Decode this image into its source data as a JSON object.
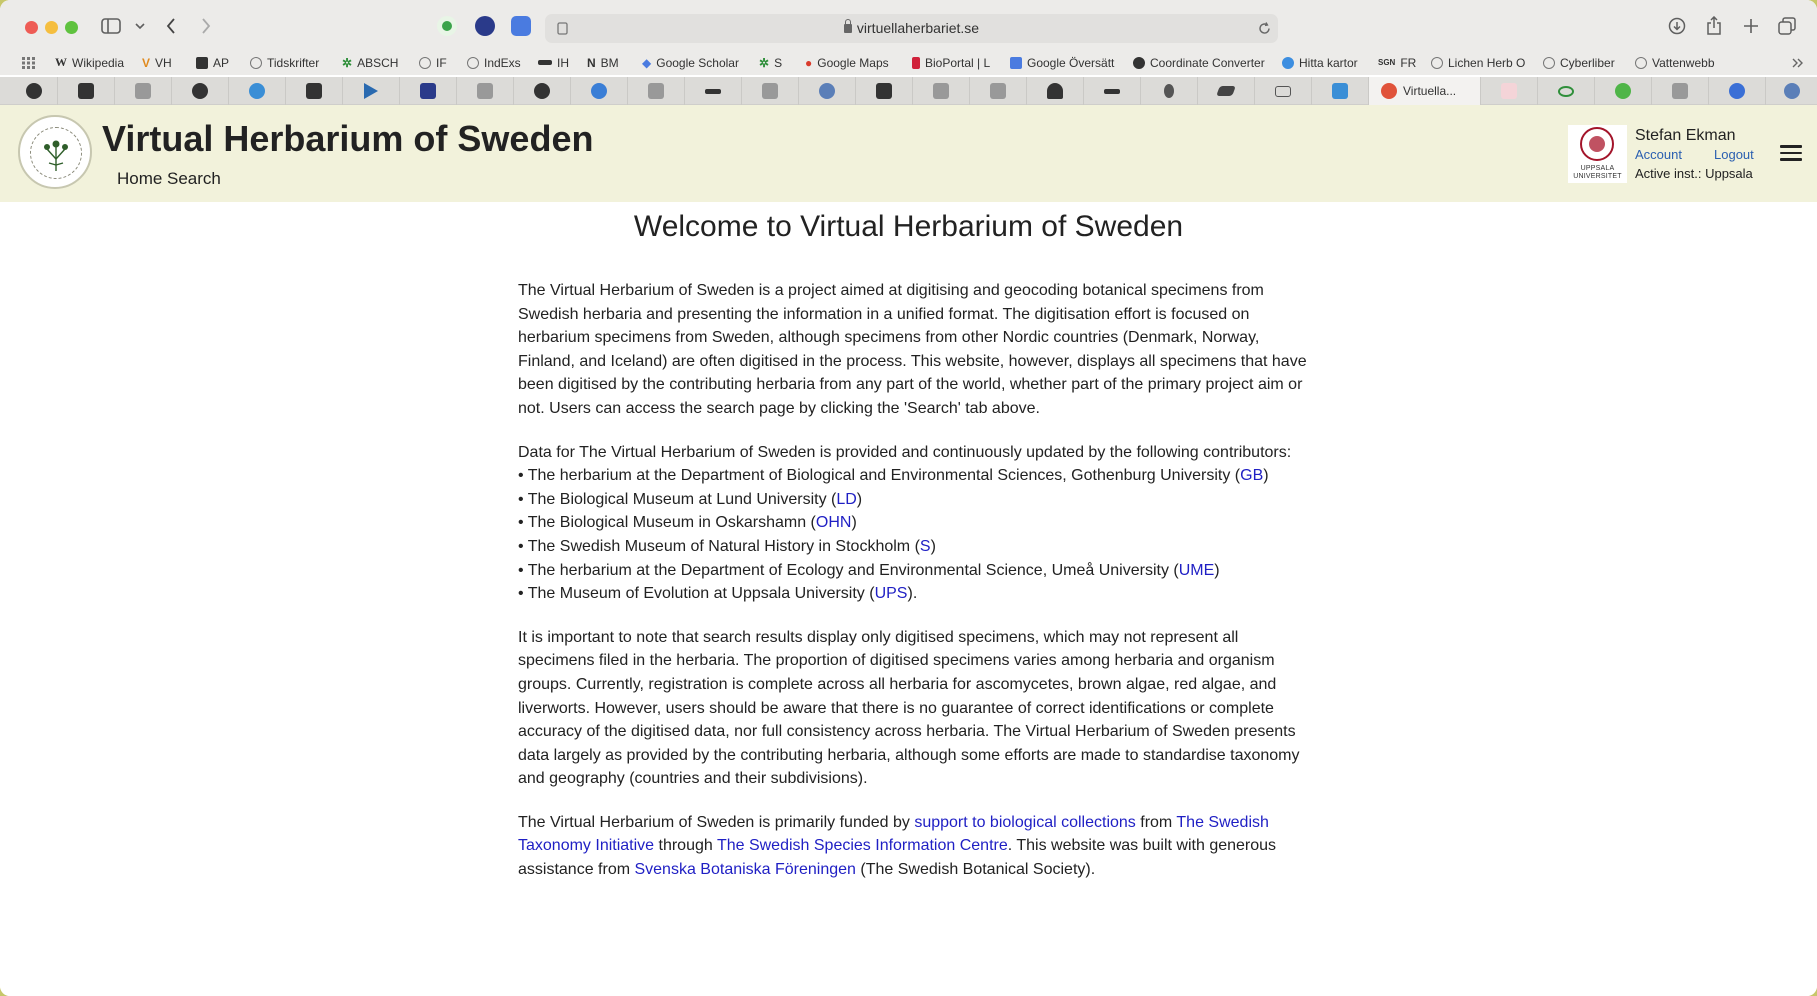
{
  "browser": {
    "url": "virtuellaherbariet.se",
    "bookmarks": [
      "Wikipedia",
      "VH",
      "AP",
      "Tidskrifter",
      "ABSCH",
      "IF",
      "IndExs",
      "IH",
      "BM",
      "Google Scholar",
      "S",
      "Google Maps",
      "BioPortal | L",
      "Google Översätt",
      "Coordinate Converter",
      "Hitta kartor",
      "FR",
      "Lichen Herb O",
      "Cyberliber",
      "Vattenwebb"
    ],
    "active_tab_label": "Virtuella..."
  },
  "site": {
    "title": "Virtual Herbarium of Sweden",
    "nav": {
      "home": "Home",
      "search": "Search"
    },
    "institution_logo_text": "UPPSALA UNIVERSITET",
    "user": {
      "name": "Stefan Ekman",
      "account": "Account",
      "logout": "Logout",
      "active_inst": "Active inst.: Uppsala"
    }
  },
  "content": {
    "heading": "Welcome to Virtual Herbarium of Sweden",
    "intro": "The Virtual Herbarium of Sweden is a project aimed at digitising and geocoding botanical specimens from Swedish herbaria and presenting the information in a unified format. The digitisation effort is focused on herbarium specimens from Sweden, although specimens from other Nordic countries (Denmark, Norway, Finland, and Iceland) are often digitised in the process. This website, however, displays all specimens that have been digitised by the contributing herbaria from any part of the world, whether part of the primary project aim or not. Users can access the search page by clicking the 'Search' tab above.",
    "contributors_intro": "Data for The Virtual Herbarium of Sweden is provided and continuously updated by the following contributors:",
    "contributors": [
      {
        "pre": "• The herbarium at the Department of Biological and Environmental Sciences, Gothenburg University (",
        "code": "GB",
        "post": ")"
      },
      {
        "pre": "• The Biological Museum at Lund University (",
        "code": "LD",
        "post": ")"
      },
      {
        "pre": "• The Biological Museum in Oskarshamn (",
        "code": "OHN",
        "post": ")"
      },
      {
        "pre": "• The Swedish Museum of Natural History in Stockholm (",
        "code": "S",
        "post": ")"
      },
      {
        "pre": "• The herbarium at the Department of Ecology and Environmental Science, Umeå University (",
        "code": "UME",
        "post": ")"
      },
      {
        "pre": "• The Museum of Evolution at Uppsala University (",
        "code": "UPS",
        "post": ")."
      }
    ],
    "note": "It is important to note that search results display only digitised specimens, which may not represent all specimens filed in the herbaria. The proportion of digitised specimens varies among herbaria and organism groups. Currently, registration is complete across all herbaria for ascomycetes, brown algae, red algae, and liverworts. However, users should be aware that there is no guarantee of correct identifications or complete accuracy of the digitised data, nor full consistency across herbaria. The Virtual Herbarium of Sweden presents data largely as provided by the contributing herbaria, although some efforts are made to standardise taxonomy and geography (countries and their subdivisions).",
    "funding": {
      "t1": "The Virtual Herbarium of Sweden is primarily funded by ",
      "l1": "support to biological collections",
      "t2": " from ",
      "l2": "The Swedish Taxonomy Initiative",
      "t3": " through ",
      "l3": "The Swedish Species Information Centre",
      "t4": ". This website was built with generous assistance from ",
      "l4": "Svenska Botaniska Föreningen",
      "t5": " (The Swedish Botanical Society)."
    }
  },
  "colors": {
    "header_bg": "#f2f2db",
    "link": "#1f1fc4",
    "account_link": "#2a5fb0",
    "uu_red": "#a3142a"
  },
  "icons": [
    "sidebar-icon",
    "back-icon",
    "forward-icon",
    "reload-icon",
    "download-icon",
    "share-icon",
    "new-tab-icon",
    "tab-overview-icon",
    "hamburger-menu-icon"
  ]
}
